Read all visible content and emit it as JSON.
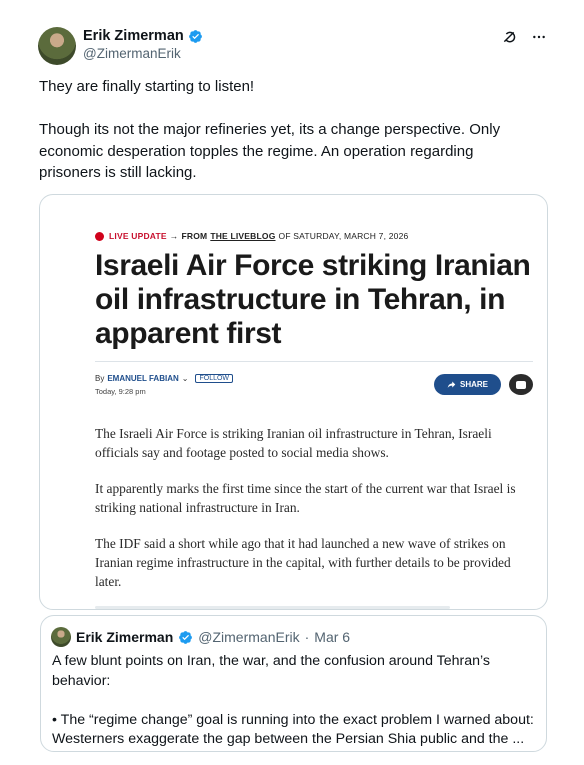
{
  "author": {
    "name": "Erik Zimerman",
    "handle": "@ZimermanErik",
    "verified": true,
    "avatar_icon": "avatar-icon"
  },
  "actions": {
    "grok_icon": "grok-icon",
    "more_icon": "more-icon"
  },
  "tweet": {
    "text": "They are finally starting to listen!\n\nThough its not the major refineries yet, its a change perspective. Only economic desperation topples the regime. An operation regarding prisoners is still lacking."
  },
  "article": {
    "live_label": "LIVE UPDATE",
    "arrow": "→",
    "from_label": "FROM",
    "liveblog_label": "THE LIVEBLOG",
    "date_label": "OF SATURDAY, MARCH 7, 2026",
    "headline": "Israeli Air Force striking Iranian oil infrastructure in Tehran, in apparent first",
    "by_label": "By",
    "author": "EMANUEL FABIAN",
    "follow_label": "FOLLOW",
    "time": "Today, 9:28 pm",
    "share_label": "SHARE",
    "paragraphs": [
      "The Israeli Air Force is striking Iranian oil infrastructure in Tehran, Israeli officials say and footage posted to social media shows.",
      "It apparently marks the first time since the start of the current war that Israel is striking national infrastructure in Iran.",
      "The IDF said a short while ago that it had launched a new wave of strikes on Iranian regime infrastructure in the capital, with further details to be provided later."
    ],
    "live_color": "#c8102e",
    "accent_color": "#1f4e8c"
  },
  "quote": {
    "name": "Erik Zimerman",
    "handle": "@ZimermanErik",
    "separator": "·",
    "date": "Mar 6",
    "text": "A few blunt points on Iran, the war, and the confusion around Tehran’s behavior:\n\n• The “regime change” goal is running into the exact problem I warned about: Westerners exaggerate the gap between the Persian Shia public and the ..."
  },
  "colors": {
    "verified": "#1d9bf0",
    "text_secondary": "#536471",
    "border": "#cfd9de"
  }
}
